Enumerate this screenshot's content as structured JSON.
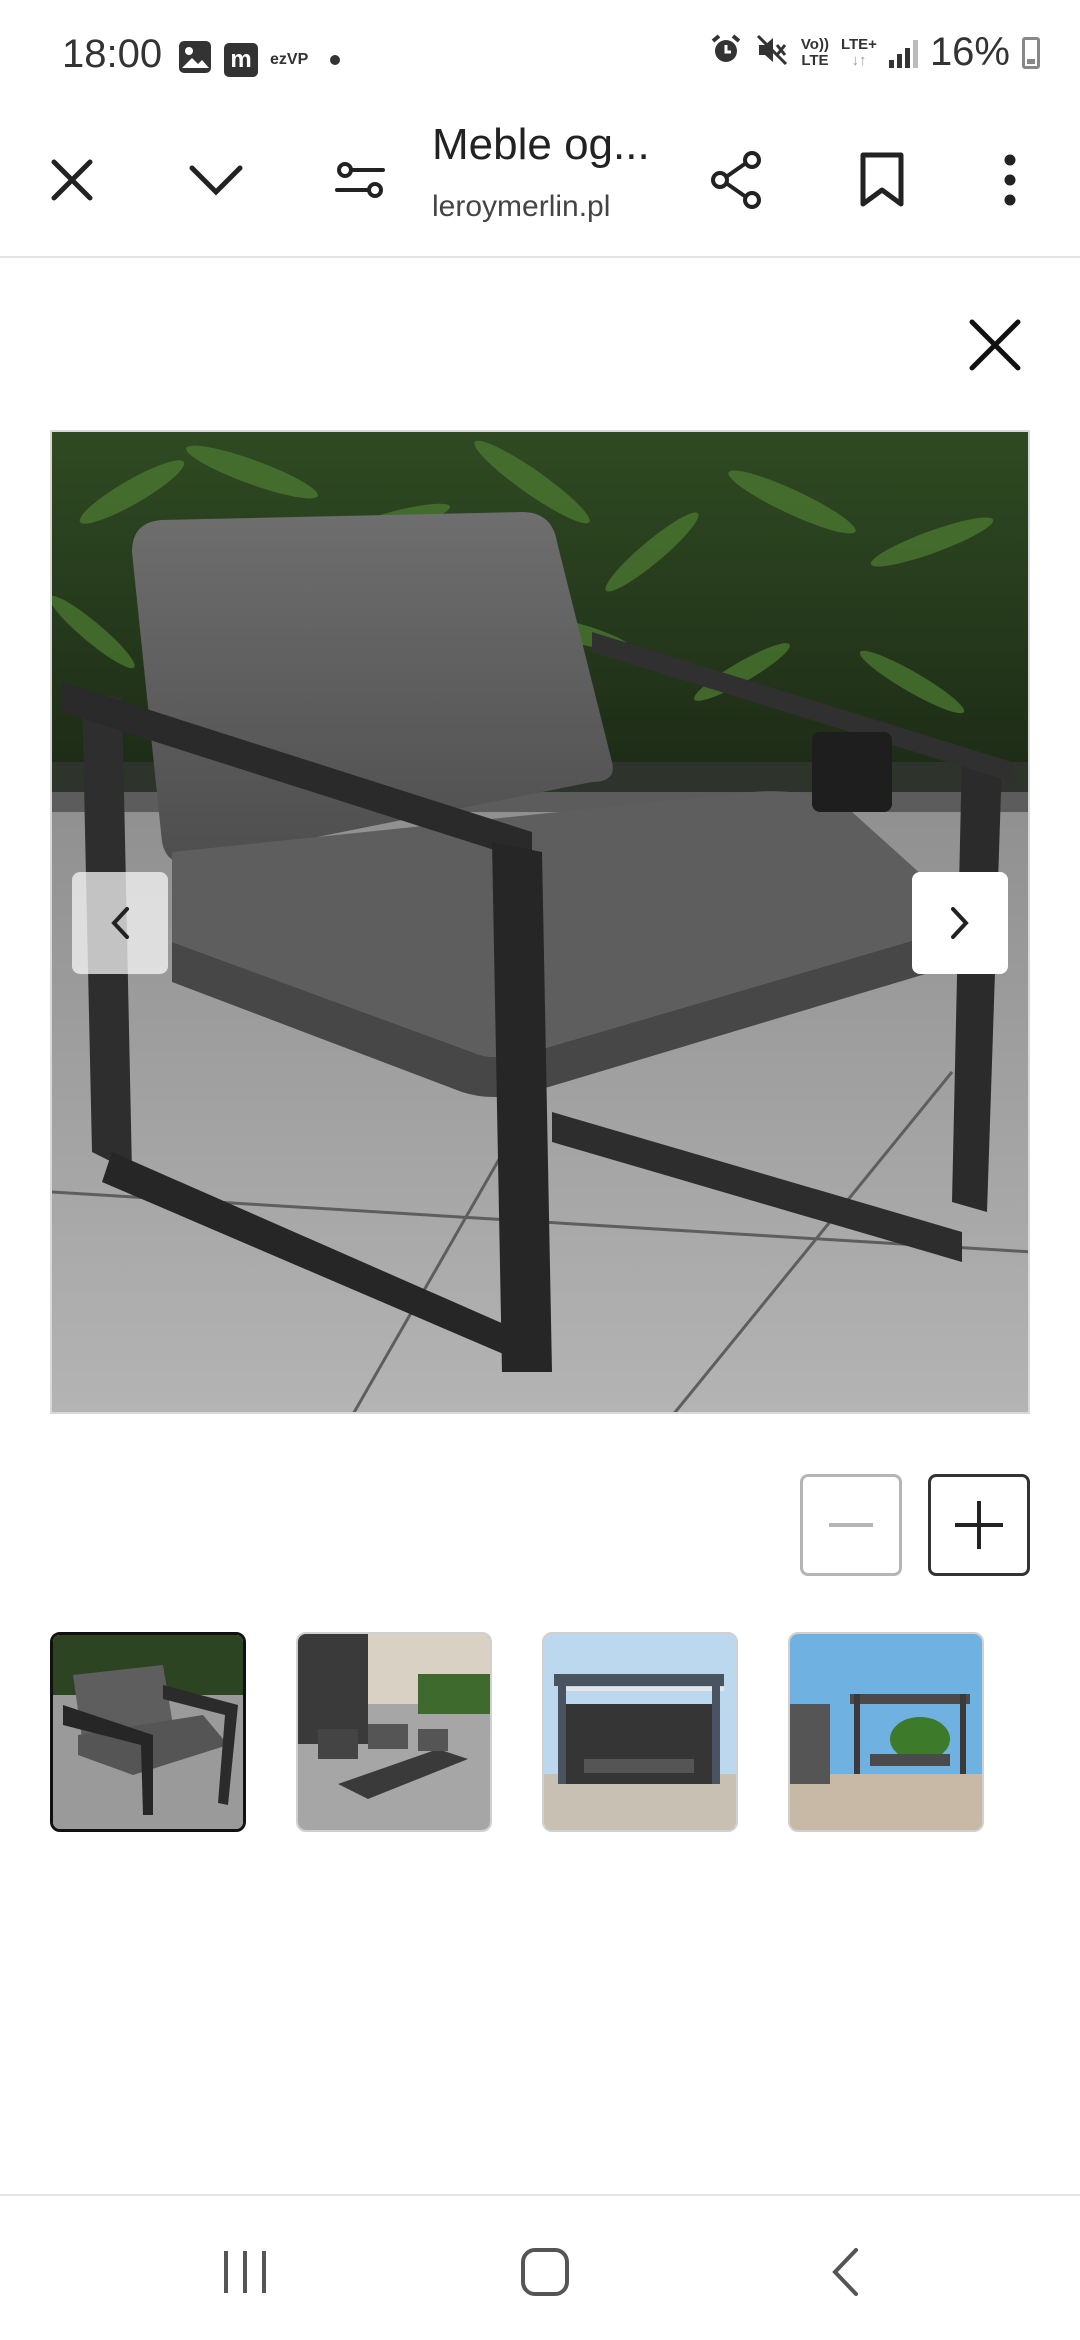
{
  "status_bar": {
    "time": "18:00",
    "app_badge": "m",
    "small_text": "ezVP",
    "network_vo": "Vo))",
    "network_lte": "LTE",
    "network_lte_plus": "LTE+",
    "battery": "16%"
  },
  "toolbar": {
    "page_title": "Meble og...",
    "domain": "leroymerlin.pl"
  },
  "gallery": {
    "thumbnails": [
      {
        "label": "thumbnail-1"
      },
      {
        "label": "thumbnail-2"
      },
      {
        "label": "thumbnail-3"
      },
      {
        "label": "thumbnail-4"
      }
    ]
  },
  "colors": {
    "icon": "#222222",
    "active_border": "#111111",
    "inactive_border": "#b5b5b5"
  }
}
